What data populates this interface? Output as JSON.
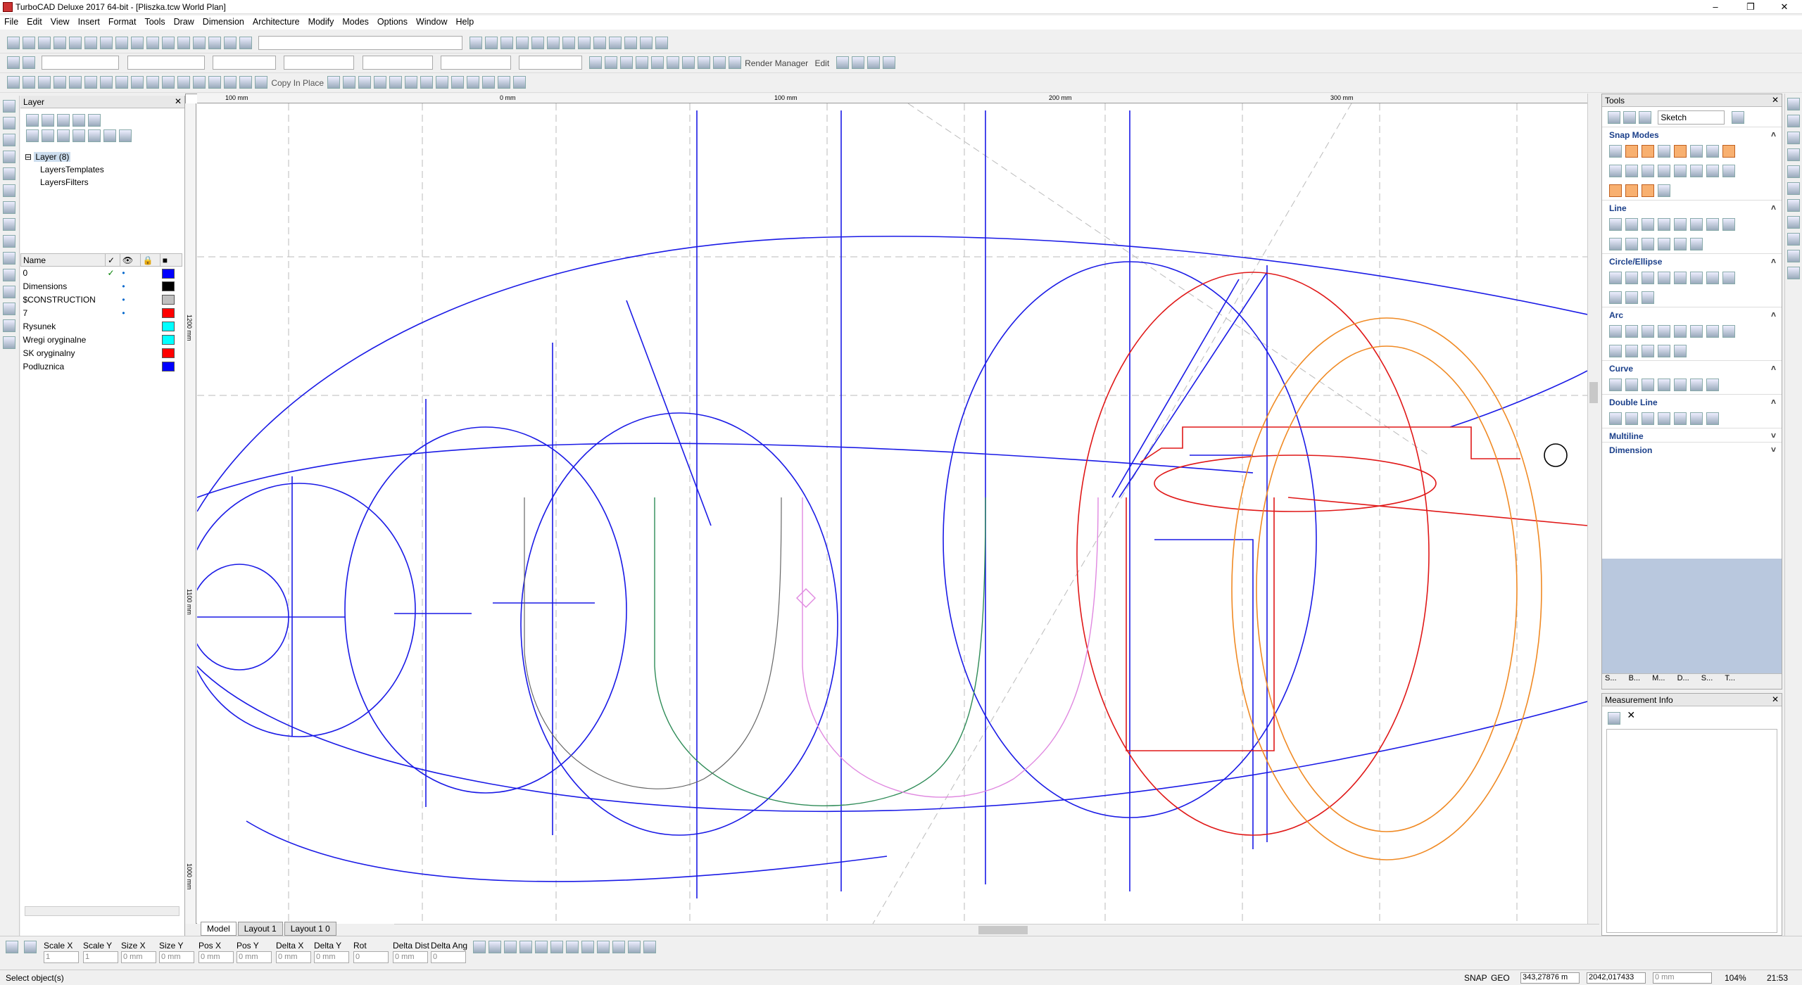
{
  "window": {
    "title": "TurboCAD Deluxe 2017 64-bit - [Pliszka.tcw World Plan]"
  },
  "menu": [
    "File",
    "Edit",
    "View",
    "Insert",
    "Format",
    "Tools",
    "Draw",
    "Dimension",
    "Architecture",
    "Modify",
    "Modes",
    "Options",
    "Window",
    "Help"
  ],
  "toolbar": {
    "copy_in_place": "Copy In Place",
    "render_manager": "Render Manager",
    "edit": "Edit",
    "sketch_select": "Sketch"
  },
  "layer_panel": {
    "title": "Layer",
    "tree": {
      "root": "Layer (8)",
      "children": [
        "LayersTemplates",
        "LayersFilters"
      ]
    },
    "columns": {
      "name": "Name"
    },
    "rows": [
      {
        "name": "0",
        "color": "#0000ff",
        "active": true,
        "visible": true
      },
      {
        "name": "Dimensions",
        "color": "#000000",
        "active": false,
        "visible": true
      },
      {
        "name": "$CONSTRUCTION",
        "color": "#c0c0c0",
        "active": false,
        "visible": true
      },
      {
        "name": "7",
        "color": "#ff0000",
        "active": false,
        "visible": true
      },
      {
        "name": "Rysunek",
        "color": "#00ffff",
        "active": false,
        "visible": false
      },
      {
        "name": "Wregi oryginalne",
        "color": "#00ffff",
        "active": false,
        "visible": false
      },
      {
        "name": "SK oryginalny",
        "color": "#ff0000",
        "active": false,
        "visible": false
      },
      {
        "name": "Podluznica",
        "color": "#0000ff",
        "active": false,
        "visible": false
      }
    ]
  },
  "ruler": {
    "h_labels": [
      "100 mm",
      "0 mm",
      "100 mm",
      "200 mm",
      "300 mm"
    ],
    "v_labels": [
      "1200 mm",
      "1100 mm",
      "1000 mm"
    ]
  },
  "tabs": [
    "Model",
    "Layout 1",
    "Layout 1 0"
  ],
  "tools_panel": {
    "title": "Tools",
    "sections": [
      "Snap Modes",
      "Line",
      "Circle/Ellipse",
      "Arc",
      "Curve",
      "Double Line",
      "Multiline",
      "Dimension"
    ],
    "bottom_tabs": [
      "S...",
      "B...",
      "M...",
      "D...",
      "S...",
      "T..."
    ]
  },
  "measurement_panel": {
    "title": "Measurement Info"
  },
  "inspector": {
    "labels": [
      "Scale X",
      "Scale Y",
      "Size X",
      "Size Y",
      "Pos X",
      "Pos Y",
      "Delta X",
      "Delta Y",
      "Rot",
      "Delta Dist",
      "Delta Ang"
    ],
    "values": [
      "1",
      "1",
      "0 mm",
      "0 mm",
      "0 mm",
      "0 mm",
      "0 mm",
      "0 mm",
      "0",
      "0 mm",
      "0"
    ]
  },
  "status": {
    "message": "Select object(s)",
    "snap": "SNAP",
    "geo": "GEO",
    "coord_x": "343,27876 m",
    "coord_y": "2042,017433",
    "coord_z": "0 mm",
    "zoom": "104%",
    "time": "21:53"
  }
}
